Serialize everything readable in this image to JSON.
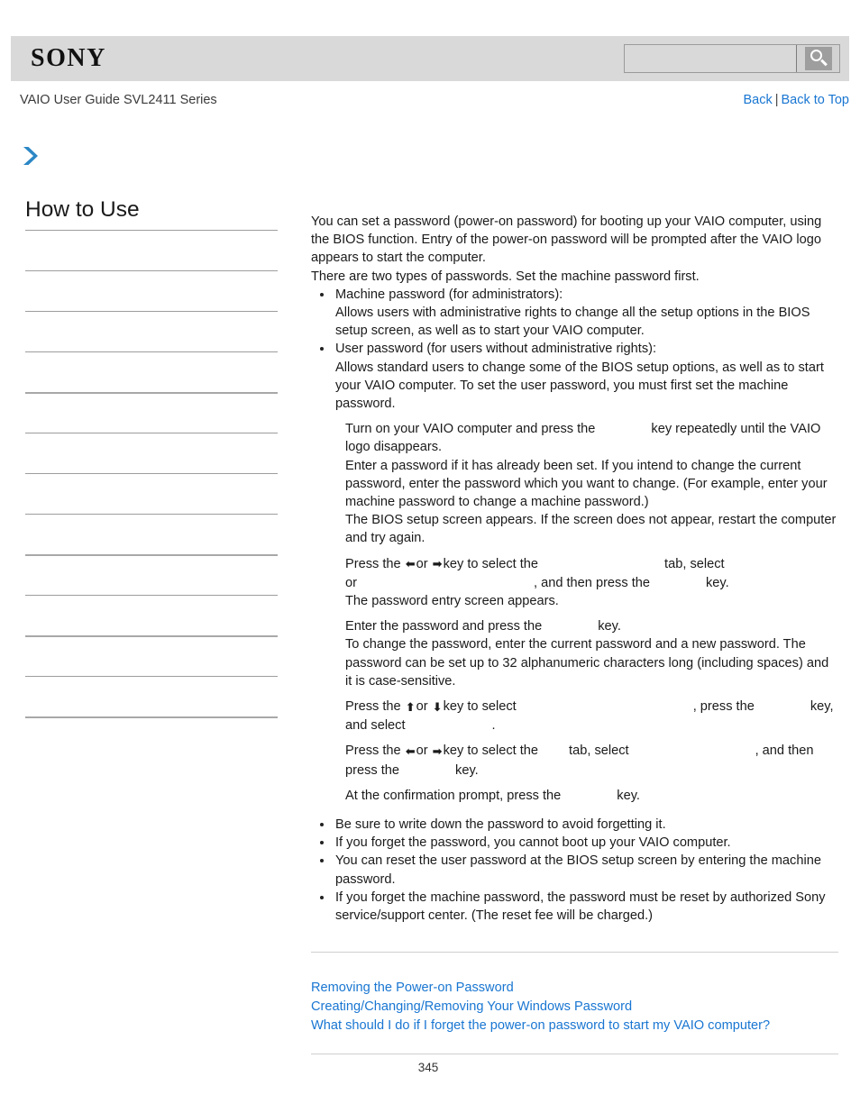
{
  "header": {
    "logo_text": "SONY",
    "logo_icon": "sony-wordmark",
    "search": {
      "value": "",
      "placeholder": "",
      "icon": "search-icon"
    }
  },
  "subheader": {
    "guide_title": "VAIO User Guide SVL2411 Series",
    "back_label": "Back",
    "separator": "|",
    "back_to_top_label": "Back to Top"
  },
  "sidebar": {
    "expand_icon": "chevron-right-icon",
    "title": "How to Use",
    "items": [
      {
        "label": ""
      },
      {
        "label": ""
      },
      {
        "label": ""
      },
      {
        "label": ""
      },
      {
        "label": ""
      },
      {
        "label": ""
      },
      {
        "label": ""
      },
      {
        "label": ""
      },
      {
        "label": ""
      },
      {
        "label": ""
      },
      {
        "label": ""
      },
      {
        "label": ""
      }
    ]
  },
  "main": {
    "intro_1": "You can set a password (power-on password) for booting up your VAIO computer, using the BIOS function. Entry of the power-on password will be prompted after the VAIO logo appears to start the computer.",
    "intro_2": "There are two types of passwords. Set the machine password first.",
    "password_types": [
      {
        "heading": "Machine password (for administrators):",
        "description": "Allows users with administrative rights to change all the setup options in the BIOS setup screen, as well as to start your VAIO computer."
      },
      {
        "heading": "User password (for users without administrative rights):",
        "description": "Allows standard users to change some of the BIOS setup options, as well as to start your VAIO computer. To set the user password, you must first set the machine password."
      }
    ],
    "steps": [
      {
        "lines": [
          "Turn on your VAIO computer and press the",
          "key repeatedly until the VAIO logo disappears."
        ]
      },
      {
        "lines": [
          "Enter a password if it has already been set. If you intend to change the current password, enter the password which you want to change. (For example, enter your machine password to change a machine password.)"
        ]
      },
      {
        "lines": [
          "The BIOS setup screen appears. If the screen does not appear, restart the computer and try again."
        ]
      },
      {
        "lines": [
          "Press the",
          "or",
          "key to select the",
          "tab, select",
          "or",
          ", and then press the",
          "key.",
          "The password entry screen appears."
        ]
      },
      {
        "lines": [
          "Enter the password and press the",
          "key.",
          "To change the password, enter the current password and a new password. The password can be set up to 32 alphanumeric characters long (including spaces) and it is case-sensitive."
        ]
      },
      {
        "lines": [
          "Press the",
          "or",
          "key to select",
          ", press the",
          "key, and select",
          "."
        ]
      },
      {
        "lines": [
          "Press the",
          "or",
          "key to select the",
          "tab, select",
          ", and then press the",
          "key."
        ]
      },
      {
        "lines": [
          "At the confirmation prompt, press the",
          "key."
        ]
      }
    ],
    "notes": [
      "Be sure to write down the password to avoid forgetting it.",
      "If you forget the password, you cannot boot up your VAIO computer.",
      "You can reset the user password at the BIOS setup screen by entering the machine password.",
      "If you forget the machine password, the password must be reset by authorized Sony service/support center. (The reset fee will be charged.)"
    ],
    "related_links": [
      "Removing the Power-on Password",
      "Creating/Changing/Removing Your Windows Password",
      "What should I do if I forget the power-on password to start my VAIO computer?"
    ]
  },
  "footer": {
    "page_number": "345"
  },
  "colors": {
    "header_bg": "#d9d9d9",
    "link": "#1976d2",
    "text": "#1a1a1a",
    "divider": "#9d9d9d",
    "accent_arrow": "#2c87c5"
  }
}
